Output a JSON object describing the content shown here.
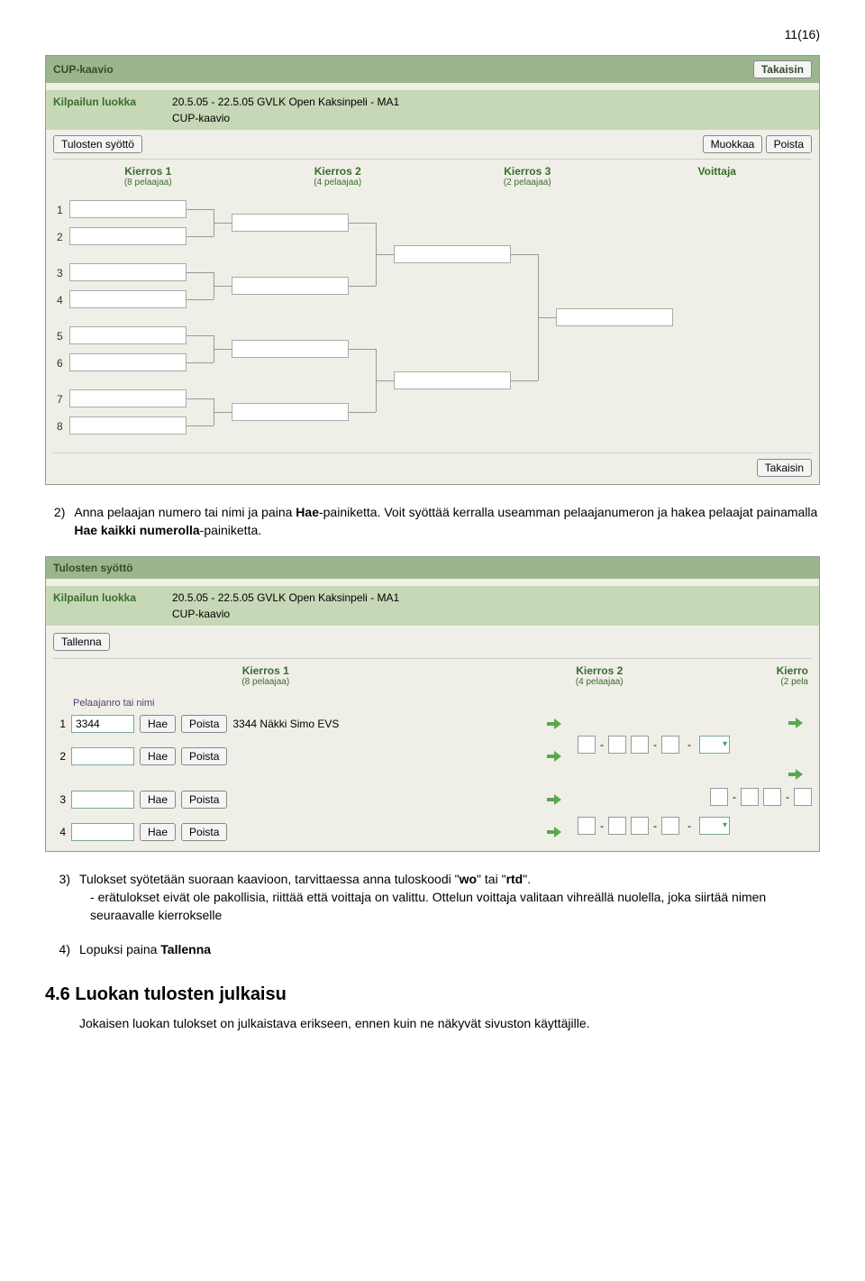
{
  "page_number": "11(16)",
  "screenshot1": {
    "title": "CUP-kaavio",
    "back": "Takaisin",
    "class_label": "Kilpailun luokka",
    "class_value": "20.5.05 - 22.5.05   GVLK Open   Kaksinpeli - MA1",
    "class_sub": "CUP-kaavio",
    "btn_results": "Tulosten syöttö",
    "btn_edit": "Muokkaa",
    "btn_delete": "Poista",
    "rounds": [
      {
        "title": "Kierros 1",
        "sub": "(8 pelaajaa)"
      },
      {
        "title": "Kierros 2",
        "sub": "(4 pelaajaa)"
      },
      {
        "title": "Kierros 3",
        "sub": "(2 pelaajaa)"
      },
      {
        "title": "Voittaja",
        "sub": ""
      }
    ],
    "rows": [
      "1",
      "2",
      "3",
      "4",
      "5",
      "6",
      "7",
      "8"
    ]
  },
  "text_block1": {
    "item2_prefix": "2)",
    "item2_a": "Anna pelaajan numero tai nimi ja paina ",
    "item2_b": "Hae",
    "item2_c": "-painiketta. Voit syöttää kerralla useamman pelaajanumeron ja hakea pelaajat painamalla ",
    "item2_d": "Hae kaikki numerolla",
    "item2_e": "-painiketta."
  },
  "screenshot2": {
    "title": "Tulosten syöttö",
    "class_label": "Kilpailun luokka",
    "class_value": "20.5.05 - 22.5.05   GVLK Open   Kaksinpeli - MA1",
    "class_sub": "CUP-kaavio",
    "btn_save": "Tallenna",
    "round1": {
      "title": "Kierros 1",
      "sub": "(8 pelaajaa)"
    },
    "round2": {
      "title": "Kierros 2",
      "sub": "(4 pelaajaa)"
    },
    "round3_partial": {
      "title": "Kierro",
      "sub": "(2 pela"
    },
    "player_label": "Pelaajanro tai nimi",
    "btn_hae": "Hae",
    "btn_poista": "Poista",
    "p1_value": "3344",
    "found_name": "3344 Näkki Simo  EVS",
    "dash": "-",
    "sep": "  -  "
  },
  "text_block2": {
    "item3_prefix": "3)",
    "item3_a": "Tulokset syötetään suoraan kaavioon, tarvittaessa anna tuloskoodi \"",
    "item3_b": "wo",
    "item3_c": "\" tai \"",
    "item3_d": "rtd",
    "item3_e": "\".",
    "dash_line": "erätulokset eivät ole pakollisia, riittää että voittaja on valittu. Ottelun voittaja valitaan vihreällä nuolella, joka siirtää nimen seuraavalle kierrokselle",
    "item4_prefix": "4)",
    "item4_a": "Lopuksi paina ",
    "item4_b": "Tallenna"
  },
  "section_heading": "4.6  Luokan tulosten julkaisu",
  "section_body": "Jokaisen luokan tulokset on julkaistava erikseen, ennen kuin ne näkyvät sivuston käyttäjille."
}
